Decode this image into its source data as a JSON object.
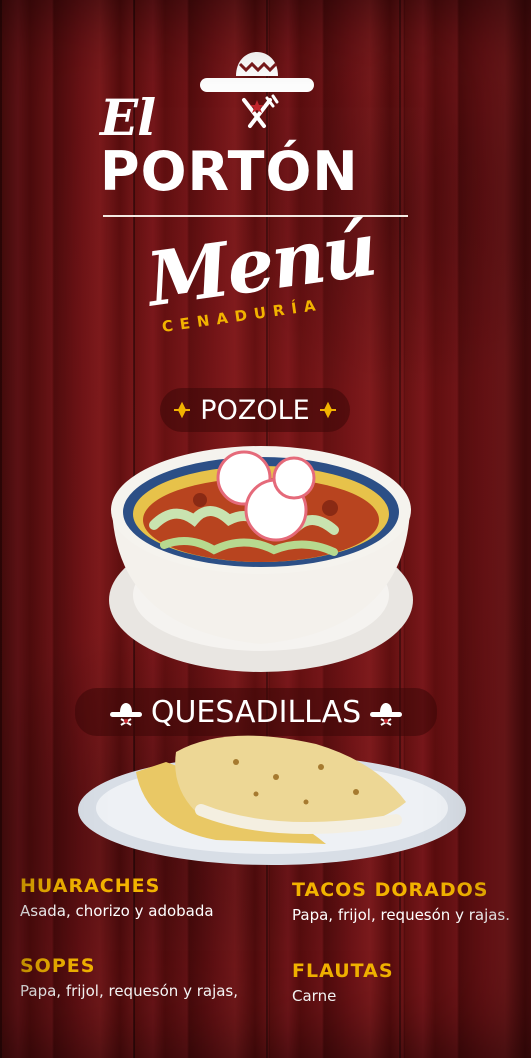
{
  "brand": {
    "prefix": "El",
    "name": "PORTÓN",
    "icon": "sombrero-utensils-icon"
  },
  "menu": {
    "title": "Menú",
    "subtitle": "CENADURÍA"
  },
  "sections": {
    "pozole": {
      "label": "POZOLE",
      "icon": "ornament-icon"
    },
    "quesadillas": {
      "label": "QUESADILLAS",
      "icon": "sombrero-icon"
    }
  },
  "items": {
    "huaraches": {
      "name": "HUARACHES",
      "desc": "Asada, chorizo y adobada"
    },
    "sopes": {
      "name": "SOPES",
      "desc": "Papa, frijol, requesón y rajas,"
    },
    "tacos": {
      "name": "TACOS DORADOS",
      "desc": "Papa, frijol, requesón y rajas."
    },
    "flautas": {
      "name": "FLAUTAS",
      "desc": "Carne"
    }
  },
  "colors": {
    "background": "#5d0f10",
    "accent": "#f2b300",
    "text": "#ffffff"
  }
}
